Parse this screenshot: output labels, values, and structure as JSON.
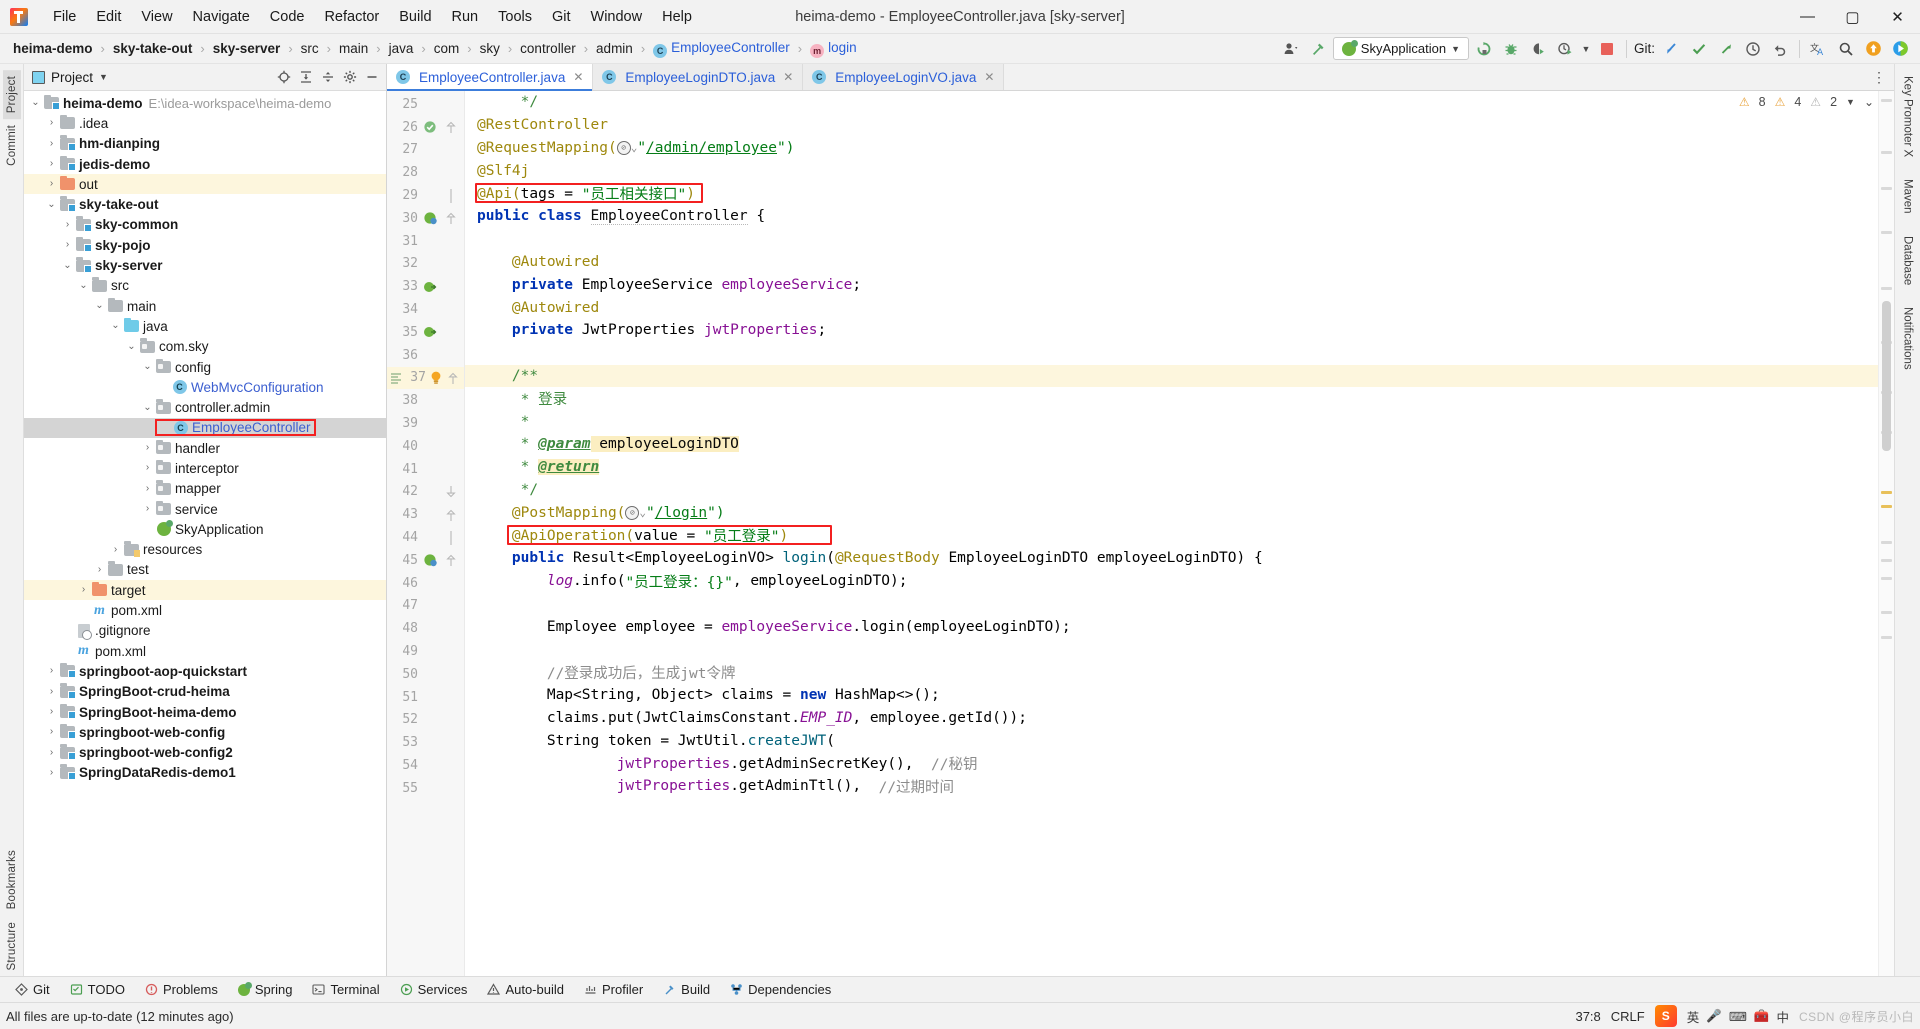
{
  "window": {
    "title": "heima-demo - EmployeeController.java [sky-server]",
    "controls": {
      "minimize": "—",
      "maximize": "▢",
      "close": "✕"
    }
  },
  "menubar": [
    "File",
    "Edit",
    "View",
    "Navigate",
    "Code",
    "Refactor",
    "Build",
    "Run",
    "Tools",
    "Git",
    "Window",
    "Help"
  ],
  "breadcrumbs": [
    {
      "label": "heima-demo",
      "style": "bold"
    },
    {
      "label": "sky-take-out",
      "style": "bold"
    },
    {
      "label": "sky-server",
      "style": "bold"
    },
    {
      "label": "src",
      "style": "plain"
    },
    {
      "label": "main",
      "style": "plain"
    },
    {
      "label": "java",
      "style": "plain"
    },
    {
      "label": "com",
      "style": "plain"
    },
    {
      "label": "sky",
      "style": "plain"
    },
    {
      "label": "controller",
      "style": "plain"
    },
    {
      "label": "admin",
      "style": "plain"
    },
    {
      "label": "EmployeeController",
      "style": "class"
    },
    {
      "label": "login",
      "style": "method"
    }
  ],
  "toolbar": {
    "run_config": "SkyApplication",
    "git_label": "Git:",
    "icons": [
      "profile-icon",
      "hammer-icon",
      "rerun-icon",
      "debug-icon",
      "coverage-icon",
      "profile-run-icon",
      "stop-icon",
      "update-project-icon",
      "commit-icon",
      "push-icon",
      "history-icon",
      "rollback-icon",
      "translate-icon",
      "search-icon",
      "upload-icon",
      "ide-play-icon"
    ]
  },
  "project_panel": {
    "title": "Project",
    "actions": [
      "locate-icon",
      "expand-all-icon",
      "collapse-all-icon",
      "gear-icon",
      "hide-icon"
    ],
    "tree": [
      {
        "label": "heima-demo",
        "suffix": "E:\\idea-workspace\\heima-demo",
        "indent": 0,
        "arrow": "down",
        "icon": "module-folder",
        "bold": true
      },
      {
        "label": ".idea",
        "indent": 1,
        "arrow": "right",
        "icon": "folder",
        "bold": false
      },
      {
        "label": "hm-dianping",
        "indent": 1,
        "arrow": "right",
        "icon": "module-folder",
        "bold": true
      },
      {
        "label": "jedis-demo",
        "indent": 1,
        "arrow": "right",
        "icon": "module-folder",
        "bold": true
      },
      {
        "label": "out",
        "indent": 1,
        "arrow": "right",
        "icon": "folder-orange",
        "bold": false,
        "highlight": "yellow"
      },
      {
        "label": "sky-take-out",
        "indent": 1,
        "arrow": "down",
        "icon": "module-folder",
        "bold": true
      },
      {
        "label": "sky-common",
        "indent": 2,
        "arrow": "right",
        "icon": "module-folder",
        "bold": true
      },
      {
        "label": "sky-pojo",
        "indent": 2,
        "arrow": "right",
        "icon": "module-folder",
        "bold": true
      },
      {
        "label": "sky-server",
        "indent": 2,
        "arrow": "down",
        "icon": "module-folder",
        "bold": true
      },
      {
        "label": "src",
        "indent": 3,
        "arrow": "down",
        "icon": "folder",
        "bold": false
      },
      {
        "label": "main",
        "indent": 4,
        "arrow": "down",
        "icon": "folder",
        "bold": false
      },
      {
        "label": "java",
        "indent": 5,
        "arrow": "down",
        "icon": "folder-cyan",
        "bold": false
      },
      {
        "label": "com.sky",
        "indent": 6,
        "arrow": "down",
        "icon": "package",
        "bold": false
      },
      {
        "label": "config",
        "indent": 7,
        "arrow": "down",
        "icon": "package",
        "bold": false
      },
      {
        "label": "WebMvcConfiguration",
        "indent": 8,
        "arrow": "none",
        "icon": "class",
        "bold": false,
        "color": "blue"
      },
      {
        "label": "controller.admin",
        "indent": 7,
        "arrow": "down",
        "icon": "package",
        "bold": false
      },
      {
        "label": "EmployeeController",
        "indent": 8,
        "arrow": "none",
        "icon": "class",
        "bold": false,
        "color": "blue",
        "selected": true,
        "redbox": true
      },
      {
        "label": "handler",
        "indent": 7,
        "arrow": "right",
        "icon": "package",
        "bold": false
      },
      {
        "label": "interceptor",
        "indent": 7,
        "arrow": "right",
        "icon": "package",
        "bold": false
      },
      {
        "label": "mapper",
        "indent": 7,
        "arrow": "right",
        "icon": "package",
        "bold": false
      },
      {
        "label": "service",
        "indent": 7,
        "arrow": "right",
        "icon": "package",
        "bold": false
      },
      {
        "label": "SkyApplication",
        "indent": 7,
        "arrow": "none",
        "icon": "spring",
        "bold": false
      },
      {
        "label": "resources",
        "indent": 5,
        "arrow": "right",
        "icon": "resources-folder",
        "bold": false
      },
      {
        "label": "test",
        "indent": 4,
        "arrow": "right",
        "icon": "folder",
        "bold": false
      },
      {
        "label": "target",
        "indent": 3,
        "arrow": "right",
        "icon": "folder-orange",
        "bold": false,
        "highlight": "yellow"
      },
      {
        "label": "pom.xml",
        "indent": 3,
        "arrow": "none",
        "icon": "maven",
        "bold": false
      },
      {
        "label": ".gitignore",
        "indent": 2,
        "arrow": "none",
        "icon": "gitignore",
        "bold": false
      },
      {
        "label": "pom.xml",
        "indent": 2,
        "arrow": "none",
        "icon": "maven",
        "bold": false
      },
      {
        "label": "springboot-aop-quickstart",
        "indent": 1,
        "arrow": "right",
        "icon": "module-folder",
        "bold": true
      },
      {
        "label": "SpringBoot-crud-heima",
        "indent": 1,
        "arrow": "right",
        "icon": "module-folder",
        "bold": true
      },
      {
        "label": "SpringBoot-heima-demo",
        "indent": 1,
        "arrow": "right",
        "icon": "module-folder",
        "bold": true
      },
      {
        "label": "springboot-web-config",
        "indent": 1,
        "arrow": "right",
        "icon": "module-folder",
        "bold": true
      },
      {
        "label": "springboot-web-config2",
        "indent": 1,
        "arrow": "right",
        "icon": "module-folder",
        "bold": true
      },
      {
        "label": "SpringDataRedis-demo1",
        "indent": 1,
        "arrow": "right",
        "icon": "module-folder",
        "bold": true
      }
    ]
  },
  "left_strip": [
    "Project",
    "Commit"
  ],
  "left_strip_bottom": [
    "Bookmarks",
    "Structure"
  ],
  "right_strip": [
    "Key Promoter X",
    "Maven",
    "Database",
    "Notifications"
  ],
  "editor": {
    "tabs": [
      {
        "label": "EmployeeController.java",
        "active": true
      },
      {
        "label": "EmployeeLoginDTO.java",
        "active": false
      },
      {
        "label": "EmployeeLoginVO.java",
        "active": false
      }
    ],
    "inspection": {
      "warnings": "8",
      "weak_warnings": "4",
      "typos": "2"
    },
    "first_line_number": 25,
    "lines": [
      {
        "n": 25,
        "segs": [
          {
            "t": "     */",
            "c": "jdoc"
          }
        ]
      },
      {
        "n": 26,
        "marker": "override",
        "segs": [
          {
            "t": "@RestController",
            "c": "ann"
          }
        ]
      },
      {
        "n": 27,
        "segs": [
          {
            "t": "@RequestMapping(",
            "c": "ann"
          },
          {
            "t": "GLOBE",
            "c": "globe"
          },
          {
            "t": "\"",
            "c": "str"
          },
          {
            "t": "/admin/employee",
            "c": "strlink"
          },
          {
            "t": "\")",
            "c": "str"
          }
        ]
      },
      {
        "n": 28,
        "segs": [
          {
            "t": "@Slf4j",
            "c": "ann"
          }
        ]
      },
      {
        "n": 29,
        "redbox": true,
        "segs": [
          {
            "t": "@Api(",
            "c": "ann"
          },
          {
            "t": "tags",
            "c": "cls2"
          },
          {
            "t": " = ",
            "c": "cls2"
          },
          {
            "t": "\"员工相关接口\"",
            "c": "str"
          },
          {
            "t": ")",
            "c": "ann"
          }
        ]
      },
      {
        "n": 30,
        "marker": "bean",
        "segs": [
          {
            "t": "public class ",
            "c": "kw"
          },
          {
            "t": "EmployeeController",
            "c": "wsq"
          },
          {
            "t": " {",
            "c": "cls2"
          }
        ]
      },
      {
        "n": 31,
        "segs": []
      },
      {
        "n": 32,
        "segs": [
          {
            "t": "    @Autowired",
            "c": "ann"
          }
        ]
      },
      {
        "n": 33,
        "marker": "impl",
        "segs": [
          {
            "t": "    private ",
            "c": "kw"
          },
          {
            "t": "EmployeeService ",
            "c": "cls2"
          },
          {
            "t": "employeeService",
            "c": "fld2"
          },
          {
            "t": ";",
            "c": "cls2"
          }
        ]
      },
      {
        "n": 34,
        "segs": [
          {
            "t": "    @Autowired",
            "c": "ann"
          }
        ]
      },
      {
        "n": 35,
        "marker": "impl",
        "segs": [
          {
            "t": "    private ",
            "c": "kw"
          },
          {
            "t": "JwtProperties ",
            "c": "cls2"
          },
          {
            "t": "jwtProperties",
            "c": "fld2"
          },
          {
            "t": ";",
            "c": "cls2"
          }
        ]
      },
      {
        "n": 36,
        "segs": []
      },
      {
        "n": 37,
        "hl": true,
        "marker": "bulb",
        "segs": [
          {
            "t": "    /**",
            "c": "jdoc"
          }
        ]
      },
      {
        "n": 38,
        "segs": [
          {
            "t": "     * 登录",
            "c": "jdoc"
          }
        ]
      },
      {
        "n": 39,
        "segs": [
          {
            "t": "     *",
            "c": "jdoc"
          }
        ]
      },
      {
        "n": 40,
        "segs": [
          {
            "t": "     * ",
            "c": "jdoc"
          },
          {
            "t": "@param",
            "c": "jdoct"
          },
          {
            "t": " employeeLoginDTO",
            "c": "hlw"
          }
        ]
      },
      {
        "n": 41,
        "segs": [
          {
            "t": "     * ",
            "c": "jdoc"
          },
          {
            "t": "@return",
            "c": "jdoct-hl"
          }
        ]
      },
      {
        "n": 42,
        "segs": [
          {
            "t": "     */",
            "c": "jdoc"
          }
        ]
      },
      {
        "n": 43,
        "segs": [
          {
            "t": "    @PostMapping(",
            "c": "ann"
          },
          {
            "t": "GLOBE",
            "c": "globe"
          },
          {
            "t": "\"",
            "c": "str"
          },
          {
            "t": "/login",
            "c": "strlink"
          },
          {
            "t": "\")",
            "c": "str"
          }
        ]
      },
      {
        "n": 44,
        "redbox": true,
        "segs": [
          {
            "t": "    @ApiOperation(",
            "c": "ann"
          },
          {
            "t": "value",
            "c": "cls2"
          },
          {
            "t": " = ",
            "c": "cls2"
          },
          {
            "t": "\"员工登录\"",
            "c": "str"
          },
          {
            "t": ")",
            "c": "ann"
          }
        ]
      },
      {
        "n": 45,
        "marker": "bean",
        "segs": [
          {
            "t": "    public ",
            "c": "kw"
          },
          {
            "t": "Result<EmployeeLoginVO> ",
            "c": "cls2"
          },
          {
            "t": "login",
            "c": "mth2"
          },
          {
            "t": "(",
            "c": "cls2"
          },
          {
            "t": "@RequestBody ",
            "c": "ann"
          },
          {
            "t": "EmployeeLoginDTO employeeLoginDTO",
            "c": "cls2"
          },
          {
            "t": ") {",
            "c": "cls2"
          }
        ]
      },
      {
        "n": 46,
        "segs": [
          {
            "t": "        ",
            "c": "cls2"
          },
          {
            "t": "log",
            "c": "stat"
          },
          {
            "t": ".info(",
            "c": "cls2"
          },
          {
            "t": "\"员工登录：{}\"",
            "c": "str"
          },
          {
            "t": ", employeeLoginDTO);",
            "c": "cls2"
          }
        ]
      },
      {
        "n": 47,
        "segs": []
      },
      {
        "n": 48,
        "segs": [
          {
            "t": "        Employee employee = ",
            "c": "cls2"
          },
          {
            "t": "employeeService",
            "c": "fld2"
          },
          {
            "t": ".login(employeeLoginDTO);",
            "c": "cls2"
          }
        ]
      },
      {
        "n": 49,
        "segs": []
      },
      {
        "n": 50,
        "segs": [
          {
            "t": "        //登录成功后，生成jwt令牌",
            "c": "cmt"
          }
        ]
      },
      {
        "n": 51,
        "segs": [
          {
            "t": "        Map<String, Object> claims = ",
            "c": "cls2"
          },
          {
            "t": "new ",
            "c": "kw"
          },
          {
            "t": "HashMap<>();",
            "c": "cls2"
          }
        ]
      },
      {
        "n": 52,
        "segs": [
          {
            "t": "        claims.put(JwtClaimsConstant.",
            "c": "cls2"
          },
          {
            "t": "EMP_ID",
            "c": "stat"
          },
          {
            "t": ", employee.getId());",
            "c": "cls2"
          }
        ]
      },
      {
        "n": 53,
        "segs": [
          {
            "t": "        String token = JwtUtil.",
            "c": "cls2"
          },
          {
            "t": "createJWT",
            "c": "mth2"
          },
          {
            "t": "(",
            "c": "cls2"
          }
        ]
      },
      {
        "n": 54,
        "segs": [
          {
            "t": "                ",
            "c": "cls2"
          },
          {
            "t": "jwtProperties",
            "c": "fld2"
          },
          {
            "t": ".getAdminSecretKey(), ",
            "c": "cls2"
          },
          {
            "t": " //秘钥",
            "c": "cmt"
          }
        ]
      },
      {
        "n": 55,
        "segs": [
          {
            "t": "                ",
            "c": "cls2"
          },
          {
            "t": "jwtProperties",
            "c": "fld2"
          },
          {
            "t": ".getAdminTtl(),  ",
            "c": "cls2"
          },
          {
            "t": "//过期时间",
            "c": "cmt"
          }
        ]
      }
    ]
  },
  "tool_windows": [
    {
      "label": "Git",
      "icon": "git-icon"
    },
    {
      "label": "TODO",
      "icon": "todo-icon"
    },
    {
      "label": "Problems",
      "icon": "problems-icon"
    },
    {
      "label": "Spring",
      "icon": "spring-icon"
    },
    {
      "label": "Terminal",
      "icon": "terminal-icon"
    },
    {
      "label": "Services",
      "icon": "services-icon"
    },
    {
      "label": "Auto-build",
      "icon": "autobuild-icon"
    },
    {
      "label": "Profiler",
      "icon": "profiler-icon"
    },
    {
      "label": "Build",
      "icon": "build-icon"
    },
    {
      "label": "Dependencies",
      "icon": "dependencies-icon"
    }
  ],
  "statusbar": {
    "message": "All files are up-to-date (12 minutes ago)",
    "caret": "37:8",
    "line_sep": "CRLF",
    "ime": [
      "英",
      "中"
    ],
    "watermark": "CSDN @程序员小白"
  }
}
